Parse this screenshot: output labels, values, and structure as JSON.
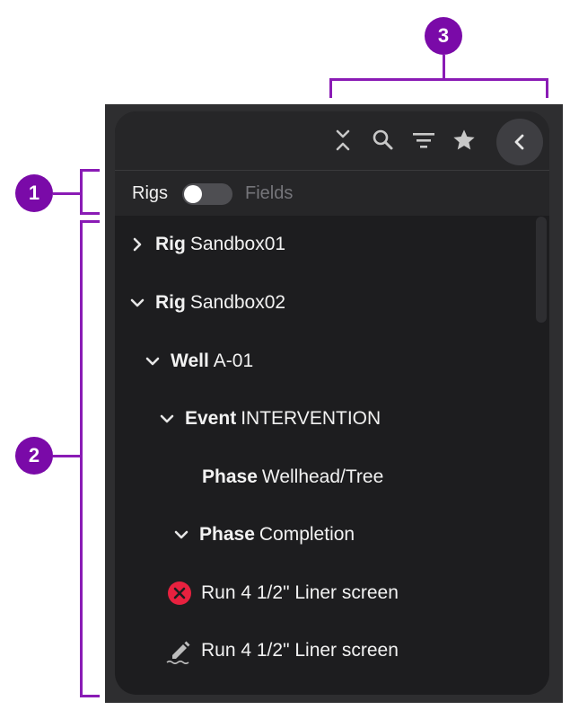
{
  "annotations": {
    "badge_1": "1",
    "badge_2": "2",
    "badge_3": "3"
  },
  "toolbar": {
    "icons": [
      "collapse-all-icon",
      "search-icon",
      "filter-icon",
      "star-icon",
      "chevron-left-icon"
    ]
  },
  "toggle": {
    "left_label": "Rigs",
    "right_label": "Fields",
    "state": "off"
  },
  "tree": {
    "rows": [
      {
        "type": "Rig",
        "name": "Sandbox01",
        "state": "collapsed"
      },
      {
        "type": "Rig",
        "name": "Sandbox02",
        "state": "expanded"
      },
      {
        "type": "Well",
        "name": "A-01",
        "state": "expanded"
      },
      {
        "type": "Event",
        "name": "INTERVENTION",
        "state": "expanded"
      },
      {
        "type": "Phase",
        "name": "Wellhead/Tree",
        "state": "leaf"
      },
      {
        "type": "Phase",
        "name": "Completion",
        "state": "expanded"
      },
      {
        "name": "Run 4 1/2\" Liner screen",
        "status_icon": "error-x-icon"
      },
      {
        "name": "Run 4 1/2\" Liner screen",
        "status_icon": "pencil-edit-icon"
      }
    ]
  },
  "colors": {
    "accent": "#7a0aa8",
    "panel": "#1d1d1f",
    "error": "#e8213f"
  }
}
